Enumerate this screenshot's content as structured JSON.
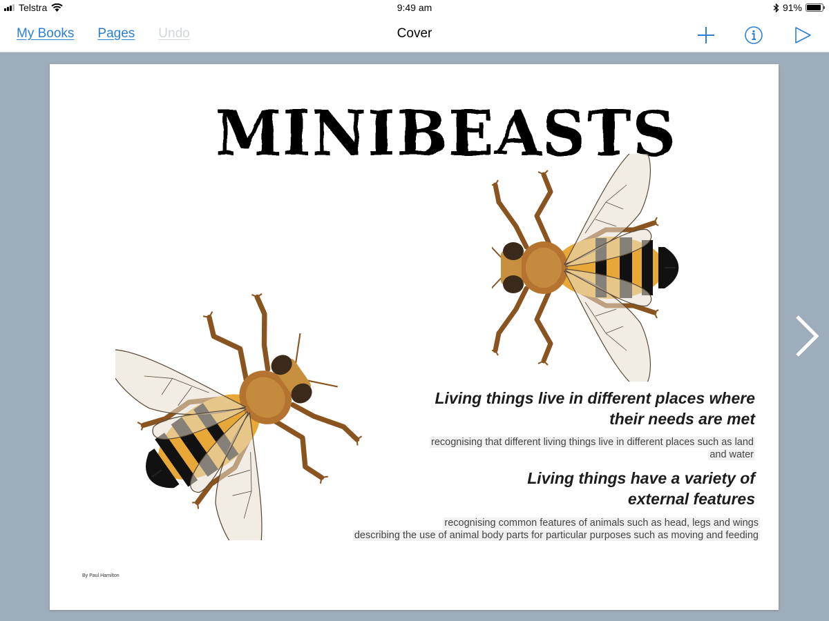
{
  "status_bar": {
    "carrier": "Telstra",
    "time": "9:49 am",
    "battery_percent": "91%",
    "battery_level": 0.91,
    "icons": [
      "signal-icon",
      "wifi-icon",
      "bluetooth-icon",
      "battery-icon"
    ]
  },
  "toolbar": {
    "my_books_label": "My Books",
    "pages_label": "Pages",
    "undo_label": "Undo",
    "title": "Cover",
    "add_icon": "plus-icon",
    "info_icon": "info-icon",
    "play_icon": "play-icon",
    "accent_color": "#2b7fd6"
  },
  "page": {
    "title": "MINIBEASTS",
    "sections": [
      {
        "heading_lines": [
          "Living things live in different places where",
          "their needs are met"
        ],
        "description_lines": [
          "recognising that different living things live in different places such as land",
          "and water"
        ]
      },
      {
        "heading_lines": [
          "Living things have a variety of",
          "external features"
        ],
        "description_lines": [
          "recognising common features of animals such as head, legs and wings",
          "describing the use of animal body parts for particular purposes such as moving and feeding"
        ]
      }
    ],
    "byline": "By Paul Hamilton",
    "images": [
      "bee-illustration",
      "bee-illustration"
    ]
  },
  "navigation": {
    "next_icon": "chevron-right-icon"
  }
}
